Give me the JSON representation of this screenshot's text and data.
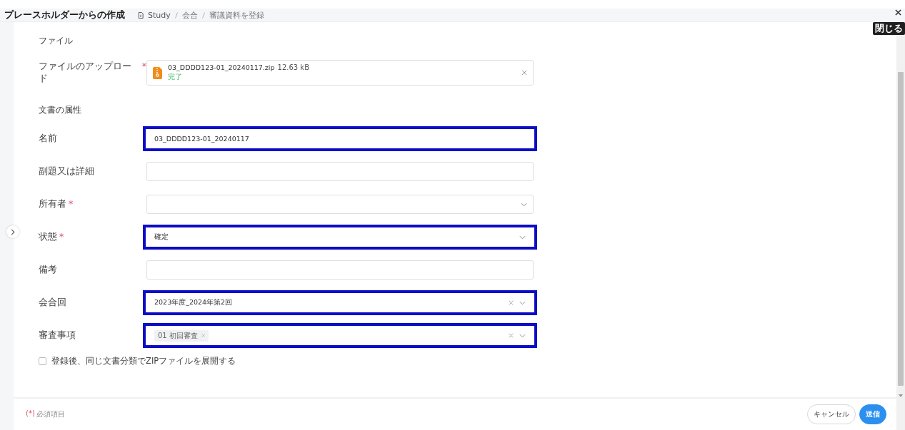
{
  "header": {
    "title": "プレースホルダーからの作成",
    "breadcrumb": [
      "Study",
      "会合",
      "審議資料を登録"
    ]
  },
  "close_tooltip": "閉じる",
  "file_section": {
    "title": "ファイル",
    "label": "ファイルのアップロード",
    "mark": "*",
    "file_name": "03_DDDD123-01_20240117.zip",
    "size": "12.63 kB",
    "status": "完了"
  },
  "attributes_section": {
    "title": "文書の属性",
    "fields": [
      {
        "label": "名前",
        "kind": "text",
        "value": "03_DDDD123-01_20240117",
        "highlighted": true
      },
      {
        "label": "副題又は詳細",
        "kind": "text",
        "highlighted": false
      },
      {
        "label": "所有者",
        "mark": "*",
        "kind": "select",
        "clearable": false,
        "highlighted": false
      },
      {
        "label": "状態",
        "mark": "*",
        "kind": "select",
        "value": "確定",
        "clearable": false,
        "highlighted": true
      },
      {
        "label": "備考",
        "kind": "text",
        "highlighted": false
      },
      {
        "label": "会合回",
        "kind": "select",
        "value": "2023年度_2024年第2回",
        "clearable": true,
        "highlighted": true
      },
      {
        "label": "審査事項",
        "kind": "multiselect",
        "tags": [
          "01 初回審査"
        ],
        "clearable": true,
        "highlighted": true
      }
    ]
  },
  "extract_option": {
    "label": "登録後、同じ文書分類でZIPファイルを展開する",
    "checked": false
  },
  "footer": {
    "note_mark": "(*)",
    "note": "必須項目",
    "buttons": [
      {
        "label": "キャンセル",
        "kind": "secondary"
      },
      {
        "label": "送信",
        "kind": "primary"
      }
    ]
  }
}
